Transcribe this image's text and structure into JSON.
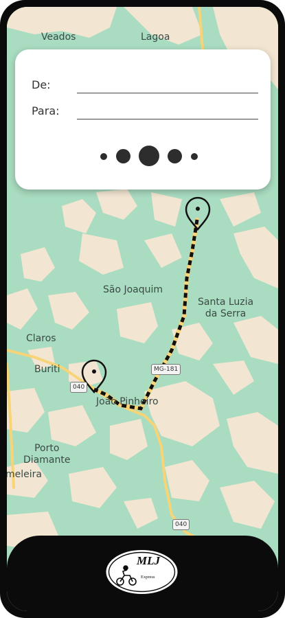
{
  "map": {
    "places": [
      {
        "name": "Veados"
      },
      {
        "name": "Lagoa"
      },
      {
        "name": "São Joaquim"
      },
      {
        "name": "Santa Luzia\nda Serra"
      },
      {
        "name": "Claros"
      },
      {
        "name": "Buriti"
      },
      {
        "name": "João Pinheiro"
      },
      {
        "name": "Porto\nDiamante"
      },
      {
        "name": "meleira"
      }
    ],
    "shields": [
      "MG-181",
      "040",
      "040"
    ],
    "origin_pin": "location-pin-icon",
    "destination_pin": "location-pin-icon"
  },
  "route_form": {
    "from_label": "De:",
    "to_label": "Para:",
    "from_value": "",
    "to_value": "",
    "pager_dots": 5,
    "active_dot": 3
  },
  "footer": {
    "logo_text": "MLJ",
    "logo_subtext": "Express"
  },
  "colors": {
    "map_green": "#a9dcc0",
    "map_beige": "#f2e6d2",
    "road": "#f7d477",
    "route": "#111111",
    "footer": "#0b0b0b"
  }
}
